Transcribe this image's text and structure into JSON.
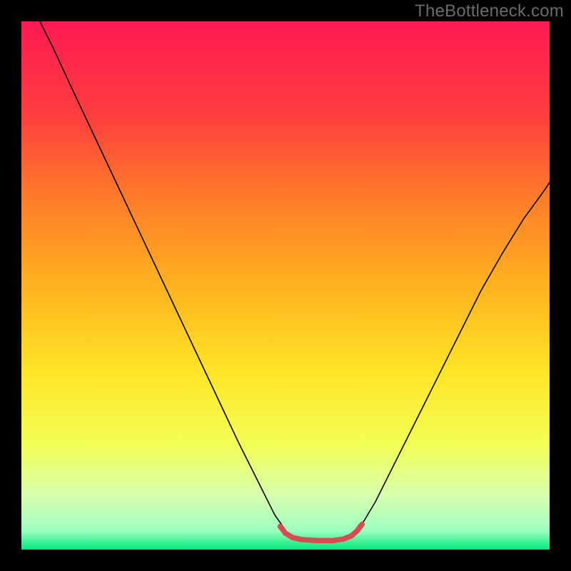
{
  "watermark": "TheBottleneck.com",
  "chart_data": {
    "type": "line",
    "title": "",
    "xlabel": "",
    "ylabel": "",
    "xlim": [
      0,
      100
    ],
    "ylim": [
      0,
      100
    ],
    "grid": false,
    "legend": false,
    "background_gradient_stops": [
      {
        "offset": 0.0,
        "color": "#ff1a53"
      },
      {
        "offset": 0.18,
        "color": "#ff3e3e"
      },
      {
        "offset": 0.33,
        "color": "#ff7a2a"
      },
      {
        "offset": 0.5,
        "color": "#ffb21f"
      },
      {
        "offset": 0.66,
        "color": "#ffe326"
      },
      {
        "offset": 0.8,
        "color": "#f3ff55"
      },
      {
        "offset": 0.9,
        "color": "#d6ffb0"
      },
      {
        "offset": 0.965,
        "color": "#9bffbf"
      },
      {
        "offset": 1.0,
        "color": "#00e87a"
      }
    ],
    "series": [
      {
        "name": "bottleneck-curve",
        "stroke": "#000000",
        "stroke_width": 1.6,
        "points": [
          {
            "x": 3.5,
            "y": 100.0
          },
          {
            "x": 6.0,
            "y": 95.0
          },
          {
            "x": 9.0,
            "y": 88.5
          },
          {
            "x": 13.0,
            "y": 80.0
          },
          {
            "x": 17.0,
            "y": 71.5
          },
          {
            "x": 21.0,
            "y": 63.0
          },
          {
            "x": 25.0,
            "y": 54.5
          },
          {
            "x": 29.0,
            "y": 46.0
          },
          {
            "x": 33.0,
            "y": 37.5
          },
          {
            "x": 37.0,
            "y": 29.0
          },
          {
            "x": 41.0,
            "y": 20.5
          },
          {
            "x": 45.0,
            "y": 12.5
          },
          {
            "x": 48.0,
            "y": 6.5
          },
          {
            "x": 50.5,
            "y": 3.0
          },
          {
            "x": 52.0,
            "y": 2.0
          },
          {
            "x": 56.0,
            "y": 1.6
          },
          {
            "x": 60.0,
            "y": 1.6
          },
          {
            "x": 62.0,
            "y": 2.2
          },
          {
            "x": 64.0,
            "y": 4.0
          },
          {
            "x": 67.0,
            "y": 9.0
          },
          {
            "x": 71.0,
            "y": 17.0
          },
          {
            "x": 75.0,
            "y": 25.0
          },
          {
            "x": 79.0,
            "y": 33.0
          },
          {
            "x": 83.0,
            "y": 41.0
          },
          {
            "x": 87.0,
            "y": 49.0
          },
          {
            "x": 91.0,
            "y": 56.0
          },
          {
            "x": 95.0,
            "y": 62.5
          },
          {
            "x": 99.0,
            "y": 68.0
          },
          {
            "x": 100.0,
            "y": 69.5
          }
        ]
      },
      {
        "name": "valley-marker",
        "stroke": "#d84b52",
        "stroke_width": 7.5,
        "linecap": "round",
        "points": [
          {
            "x": 49.0,
            "y": 4.4
          },
          {
            "x": 50.0,
            "y": 3.1
          },
          {
            "x": 51.3,
            "y": 2.3
          },
          {
            "x": 53.0,
            "y": 1.9
          },
          {
            "x": 56.0,
            "y": 1.7
          },
          {
            "x": 59.0,
            "y": 1.7
          },
          {
            "x": 61.0,
            "y": 2.0
          },
          {
            "x": 62.5,
            "y": 2.6
          },
          {
            "x": 63.6,
            "y": 3.6
          },
          {
            "x": 64.5,
            "y": 4.8
          }
        ]
      }
    ]
  }
}
